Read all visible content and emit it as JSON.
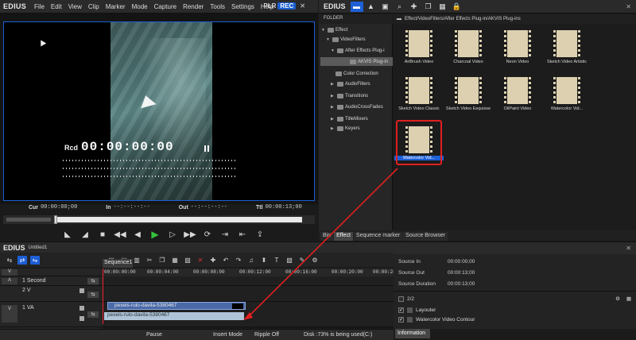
{
  "menubar": {
    "brand": "EDIUS",
    "items": [
      "File",
      "Edit",
      "View",
      "Clip",
      "Marker",
      "Mode",
      "Capture",
      "Render",
      "Tools",
      "Settings",
      "Help"
    ],
    "plr": "PLR",
    "rec": "REC"
  },
  "player": {
    "tc_label": "Rcd",
    "timecode": "00:00:00:00",
    "cur_label": "Cur",
    "cur": "00:00:00;00",
    "in_label": "In",
    "in": "--:--:--:--",
    "out_label": "Out",
    "out": "--:--:--:--",
    "ttl_label": "Ttl",
    "ttl": "00:00:13;00"
  },
  "right_panel": {
    "brand": "EDIUS",
    "folder_header": "FOLDER",
    "path": "Effect/VideoFilters/After Effects Plug-in/AKVIS Plug-ins",
    "tree": [
      {
        "label": "Effect"
      },
      {
        "label": "VideoFilters"
      },
      {
        "label": "After Effects Plug-i"
      },
      {
        "label": "AKVIS Plug-in"
      },
      {
        "label": "Color Correction"
      },
      {
        "label": "AudioFilters"
      },
      {
        "label": "Transitions"
      },
      {
        "label": "AudioCrossFades"
      },
      {
        "label": "TitleMixers"
      },
      {
        "label": "Keyers"
      }
    ],
    "effects": [
      {
        "label": "AirBrush Video"
      },
      {
        "label": "Charcoal Video"
      },
      {
        "label": "Neon Video"
      },
      {
        "label": "Sketch Video Artistic"
      },
      {
        "label": "Sketch Video Classic"
      },
      {
        "label": "Sketch Video Esquisse"
      },
      {
        "label": "OilPaint Video"
      },
      {
        "label": "Watercolor Vid..."
      },
      {
        "label": "Watercolor Vid..."
      }
    ],
    "tabs": [
      "Bin",
      "Effect",
      "Sequence marker",
      "Source Browser"
    ]
  },
  "timeline": {
    "brand": "EDIUS",
    "project": "Untitled1",
    "sequence_tab": "Sequence1",
    "ruler": [
      "00:00:00:00",
      "00:00:04:00",
      "00:00:08:00",
      "00:00:12:00",
      "00:00:16:00",
      "00:00:20:00",
      "00:00:24:00"
    ],
    "tracks": [
      {
        "tag": "V",
        "name": ""
      },
      {
        "tag": "A",
        "name": "1 Second"
      },
      {
        "tag": "",
        "name": "2 V"
      },
      {
        "tag": "V",
        "name": "1 VA"
      }
    ],
    "clip_video": "pexels-rulo-davila-5380467",
    "clip_audio": "pexels-rulo-davila-5380467"
  },
  "status": {
    "pause": "Pause",
    "mode": "Insert Mode",
    "ripple": "Ripple Off",
    "disk": "Disk :73% is being used(C:)"
  },
  "info": {
    "rows": [
      {
        "label": "Source In",
        "value": "00:00:00;00"
      },
      {
        "label": "Source Out",
        "value": "00:00:13;00"
      },
      {
        "label": "Source Duration",
        "value": "00:00:13;00"
      }
    ],
    "layer_count": "2/2",
    "layers": [
      {
        "label": "Layouter"
      },
      {
        "label": "Watercolor Video Contour"
      }
    ],
    "tab": "Information"
  }
}
